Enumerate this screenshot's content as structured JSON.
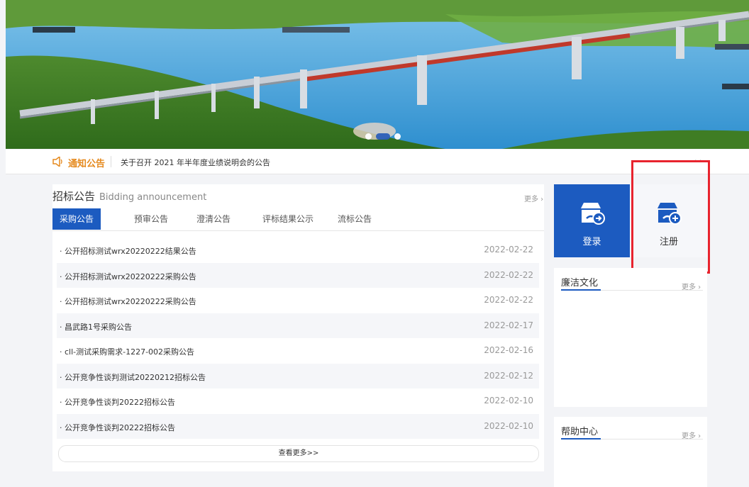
{
  "banner": {
    "slides": 3,
    "active_slide": 2
  },
  "notice": {
    "title": "通知公告",
    "text": "关于召开 2021 年半年度业绩说明会的公告",
    "nav": "‹ ›"
  },
  "bidding": {
    "title": "招标公告",
    "title_en": "Bidding announcement",
    "more": "更多 ›",
    "tabs": [
      "采购公告",
      "预审公告",
      "澄清公告",
      "评标结果公示",
      "流标公告"
    ],
    "active_tab": 0,
    "rows": [
      {
        "title": "· 公开招标测试wrx20220222结果公告",
        "date": "2022-02-22"
      },
      {
        "title": "· 公开招标测试wrx20220222采购公告",
        "date": "2022-02-22"
      },
      {
        "title": "· 公开招标测试wrx20220222采购公告",
        "date": "2022-02-22"
      },
      {
        "title": "· 昌武路1号采购公告",
        "date": "2022-02-17"
      },
      {
        "title": "· cll-测试采购需求-1227-002采购公告",
        "date": "2022-02-16"
      },
      {
        "title": "· 公开竞争性谈判测试20220212招标公告",
        "date": "2022-02-12"
      },
      {
        "title": "· 公开竞争性谈判20222招标公告",
        "date": "2022-02-10"
      },
      {
        "title": "· 公开竞争性谈判20222招标公告",
        "date": "2022-02-10"
      }
    ],
    "view_more": "查看更多>>"
  },
  "auth": {
    "login_label": "登录",
    "register_label": "注册"
  },
  "integrity": {
    "title": "廉洁文化",
    "more": "更多 ›"
  },
  "help": {
    "title": "帮助中心",
    "more": "更多 ›"
  },
  "colors": {
    "primary": "#1c5bc0",
    "notice": "#e58a1f",
    "highlight": "#e8242e"
  }
}
